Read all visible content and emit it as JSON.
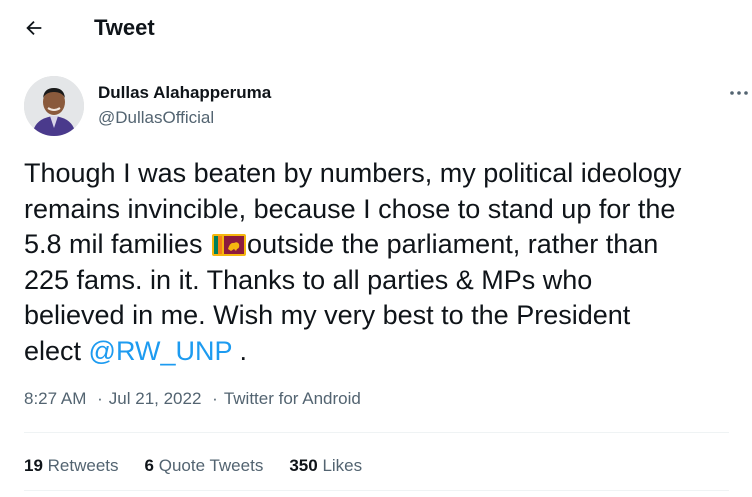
{
  "header": {
    "title": "Tweet",
    "back_icon": "arrow-left-icon"
  },
  "author": {
    "name": "Dullas Alahapperuma",
    "handle": "@DullasOfficial",
    "avatar_icon": "user-avatar-photo",
    "more_icon": "more-horizontal-icon"
  },
  "tweet": {
    "line1": "Though I was beaten by numbers, my political ideology",
    "line2": "remains invincible, because I chose to stand up for the",
    "line3_pre": "5.8 mil families ",
    "line3_post": "outside the parliament, rather than",
    "line4": "225 fams. in it. Thanks to all parties & MPs who",
    "line5": "believed in me. Wish my very best to the President",
    "line6_pre": "elect ",
    "mention": "@RW_UNP",
    "line6_post": " .",
    "flag_icon": "sri-lanka-flag-emoji"
  },
  "meta": {
    "time": "8:27 AM",
    "separator": "·",
    "date": "Jul 21, 2022",
    "source": "Twitter for Android"
  },
  "stats": {
    "retweets_count": "19",
    "retweets_label": "Retweets",
    "quotes_count": "6",
    "quotes_label": "Quote Tweets",
    "likes_count": "350",
    "likes_label": "Likes"
  },
  "colors": {
    "text": "#0f1419",
    "secondary": "#536471",
    "link": "#1d9bf0",
    "divider": "#eff3f4"
  }
}
